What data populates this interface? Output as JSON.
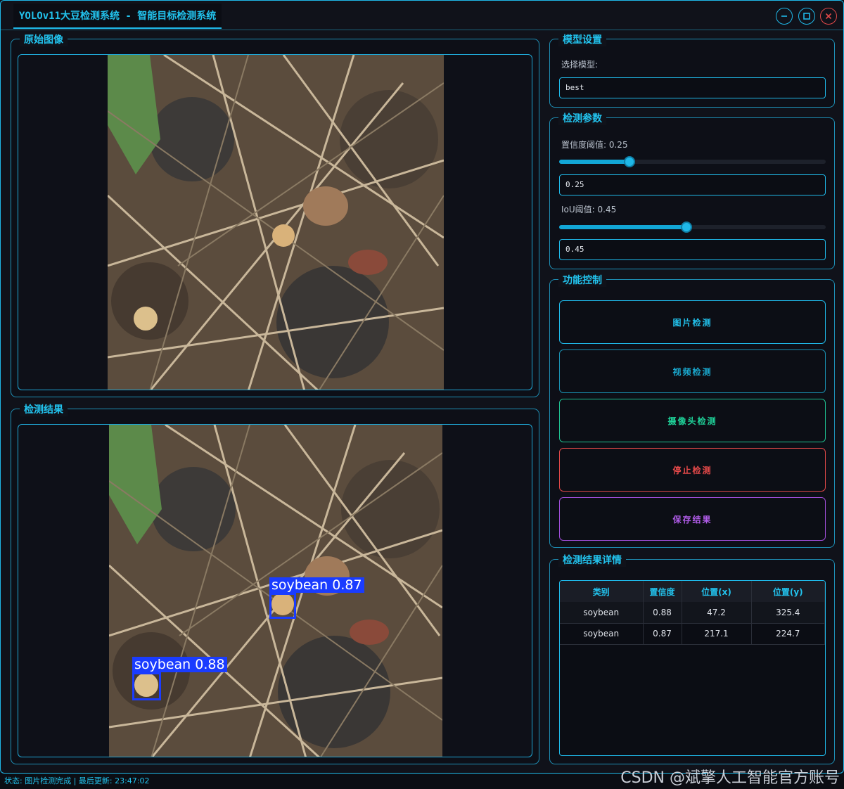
{
  "window": {
    "title": "YOLOv11大豆检测系统 - 智能目标检测系统"
  },
  "original": {
    "title": "原始图像"
  },
  "result": {
    "title": "检测结果"
  },
  "model": {
    "title": "模型设置",
    "select_label": "选择模型:",
    "selected": "best"
  },
  "params": {
    "title": "检测参数",
    "conf_label": "置信度阈值: 0.25",
    "conf_value": "0.25",
    "conf": 0.25,
    "iou_label": "IoU阈值: 0.45",
    "iou_value": "0.45",
    "iou": 0.45
  },
  "controls": {
    "title": "功能控制",
    "image": "图片检测",
    "video": "视频检测",
    "camera": "摄像头检测",
    "stop": "停止检测",
    "save": "保存结果"
  },
  "details": {
    "title": "检测结果详情",
    "headers": [
      "类别",
      "置信度",
      "位置(x)",
      "位置(y)"
    ],
    "rows": [
      [
        "soybean",
        "0.88",
        "47.2",
        "325.4"
      ],
      [
        "soybean",
        "0.87",
        "217.1",
        "224.7"
      ]
    ]
  },
  "detections": [
    {
      "label": "soybean 0.87"
    },
    {
      "label": "soybean 0.88"
    }
  ],
  "status": {
    "text": "状态: 图片检测完成 | 最后更新: 23:47:02"
  },
  "watermark": "CSDN @斌擎人工智能官方账号",
  "colors": {
    "accent": "#22c3ee",
    "stop": "#e84a4a",
    "camera": "#1fd39a",
    "save": "#b05ce8",
    "box": "#1a3cff"
  }
}
